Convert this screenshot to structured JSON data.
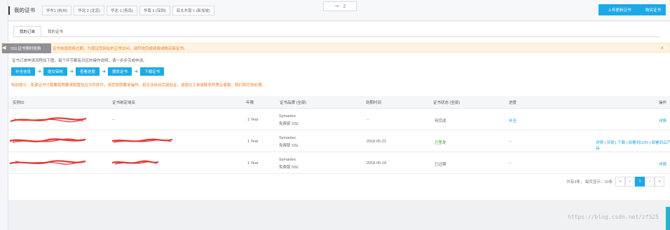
{
  "header": {
    "title": "我的证书",
    "regions": [
      "华东1 (杭州)",
      "华北 2 (北京)",
      "华北 1 (青岛)",
      "华南 1 (深圳)",
      "亚太东南 1 (新加坡)"
    ],
    "center_value": "2",
    "buttons": [
      "上传更新证书",
      "购买证书"
    ]
  },
  "tabs": [
    "我的订单",
    "我的证书"
  ],
  "warning": {
    "label": "SSL证书限时抢购",
    "text": "证书信息即将过期，为保证您网站的正常访问，请尽快完成续费或购买新证书。",
    "close_icon": "close-icon"
  },
  "intro": "证书订单申请流程如下图，每个环节都有对应的操作说明，请一步步完成申请。",
  "steps": [
    "补全信息",
    "提交审核",
    "查看进度",
    "颁发证书",
    "下载证书"
  ],
  "hint": "特别提示：免费证书只需要按照要求配置验证文件即可，请您按照要求操作，若无法自动完成验证，请提交工单或联系阿里云客服，我们将尽快处理。",
  "table": {
    "headers": [
      "实例ID",
      "证书绑定域名",
      "年限",
      "证书品牌 (全部)",
      "到期时间",
      "证书状态 (全部)",
      "进度",
      "操作"
    ],
    "rows": [
      {
        "domain": "--",
        "years": "1 Year",
        "brand": "Symantec",
        "edition": "免费版 SSL",
        "expiry": "--",
        "status": "待完成",
        "progress": "补全",
        "actions": [
          "详情"
        ]
      },
      {
        "domain": "",
        "years": "1 Year",
        "brand": "Symantec",
        "edition": "免费版 SSL",
        "expiry": "2018-05-21",
        "status": "已签发",
        "progress": "--",
        "actions": [
          "详情",
          "吊销",
          "下载",
          "部署到CDN",
          "部署到云产品"
        ]
      },
      {
        "domain": "",
        "years": "1 Year",
        "brand": "Symantec",
        "edition": "免费版 SSL",
        "expiry": "2018-05-18",
        "status": "已过期",
        "progress": "--",
        "actions": [
          "详情"
        ]
      }
    ]
  },
  "pagination": {
    "summary": "共有3条， 每页显示：10条",
    "buttons": [
      "«",
      "‹",
      "1",
      "›",
      "»"
    ],
    "active_page": "1"
  },
  "watermark": "https://blog.csdn.net/zf525",
  "colors": {
    "accent": "#1da9e8",
    "warning_text": "#f37b1d",
    "warning_bg": "#fff4e3",
    "success": "#2ba22b",
    "redaction": "#e53935"
  }
}
